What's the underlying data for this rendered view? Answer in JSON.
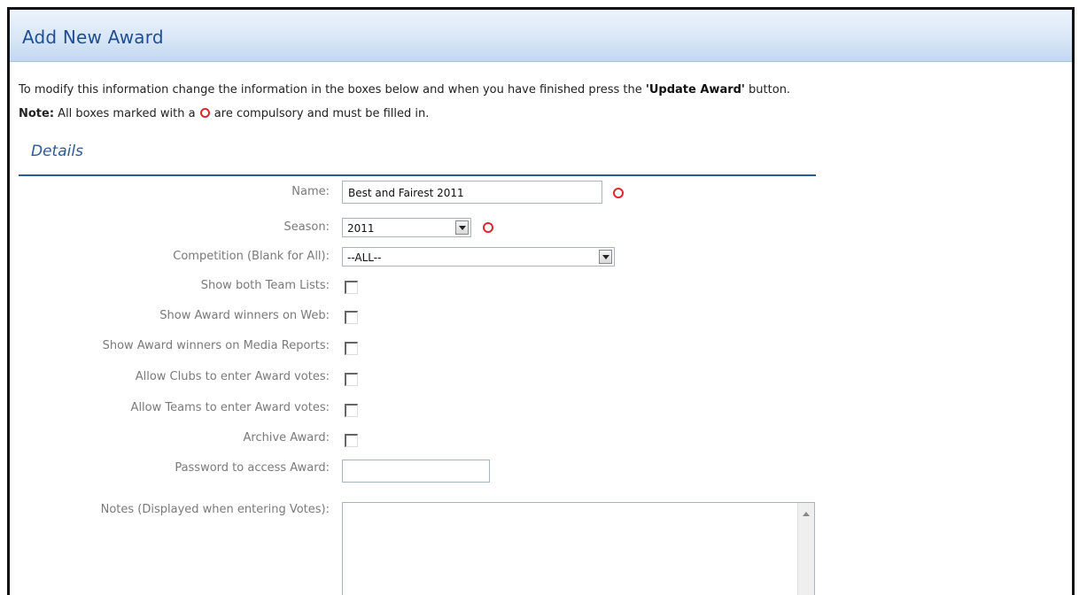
{
  "header": {
    "title": "Add New Award"
  },
  "intro": {
    "text_before": "To modify this information change the information in the boxes below and when you have finished press the ",
    "button_ref": "'Update Award'",
    "text_after": " button."
  },
  "note": {
    "label": "Note:",
    "text_before": " All boxes marked with a ",
    "text_after": " are compulsory and must be filled in."
  },
  "section": {
    "title": "Details"
  },
  "form": {
    "name": {
      "label": "Name:",
      "value": "Best and Fairest 2011"
    },
    "season": {
      "label": "Season:",
      "value": "2011"
    },
    "competition": {
      "label": "Competition (Blank for All):",
      "value": "--ALL--"
    },
    "show_team_lists": {
      "label": "Show both Team Lists:",
      "checked": false
    },
    "show_web": {
      "label": "Show Award winners on Web:",
      "checked": false
    },
    "show_media": {
      "label": "Show Award winners on Media Reports:",
      "checked": false
    },
    "allow_clubs": {
      "label": "Allow Clubs to enter Award votes:",
      "checked": false
    },
    "allow_teams": {
      "label": "Allow Teams to enter Award votes:",
      "checked": false
    },
    "archive": {
      "label": "Archive Award:",
      "checked": false
    },
    "password": {
      "label": "Password to access Award:",
      "value": ""
    },
    "notes": {
      "label": "Notes (Displayed when entering Votes):",
      "value": ""
    }
  },
  "colors": {
    "required_mark": "#e3242b",
    "header_text": "#1f4e91",
    "section_rule": "#2e5a96"
  },
  "icons": [
    "required-icon",
    "dropdown-arrow-icon",
    "scroll-up-icon"
  ]
}
